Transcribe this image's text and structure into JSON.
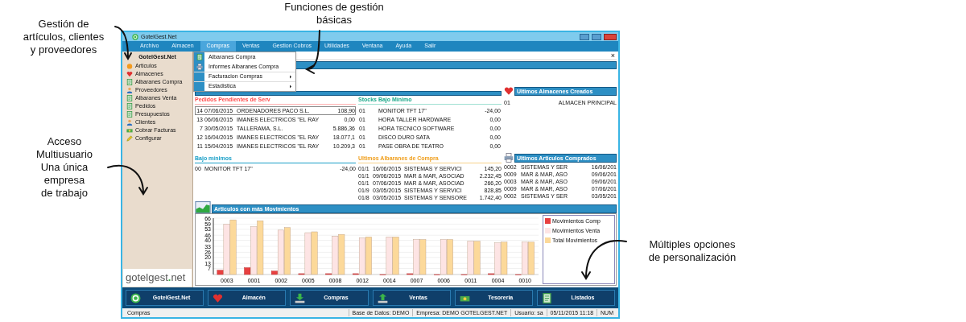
{
  "annotations": [
    {
      "kind": "top-left",
      "lines": [
        "Gestión de",
        "artículos, clientes",
        "y proveedores"
      ]
    },
    {
      "kind": "top-center",
      "lines": [
        "Funciones de gestión",
        "básicas"
      ]
    },
    {
      "kind": "mid-left",
      "lines": [
        "Acceso",
        "Multiusuario",
        "Una única",
        "empresa",
        "de trabajo"
      ]
    },
    {
      "kind": "bottom-right",
      "lines": [
        "Múltiples opciones",
        "de personalización"
      ]
    }
  ],
  "window": {
    "title": "GotelGest.Net"
  },
  "menu": [
    {
      "label": "Archivo",
      "selected": false
    },
    {
      "label": "Almacen",
      "selected": false
    },
    {
      "label": "Compras",
      "selected": true
    },
    {
      "label": "Ventas",
      "selected": false
    },
    {
      "label": "Gestion Cobros",
      "selected": false
    },
    {
      "label": "Utilidades",
      "selected": false
    },
    {
      "label": "Ventana",
      "selected": false
    },
    {
      "label": "Ayuda",
      "selected": false
    },
    {
      "label": "Salir",
      "selected": false
    }
  ],
  "dropdown": [
    {
      "label": "Albaranes Compra",
      "kind": "document"
    },
    {
      "label": "Informes Albaranes Compra",
      "kind": "printer"
    },
    {
      "label": "Facturacion Compras",
      "kind": "submenu"
    },
    {
      "label": "Estadistica",
      "kind": "submenu"
    }
  ],
  "panel": {
    "close": "×"
  },
  "sidebar": {
    "title": "GotelGest.Net",
    "items": [
      {
        "label": "Articulos",
        "kind": "ball"
      },
      {
        "label": "Almacenes",
        "kind": "heart"
      },
      {
        "label": "Albaranes Compra",
        "kind": "document"
      },
      {
        "label": "Proveedores",
        "kind": "person"
      },
      {
        "label": "Albaranes Venta",
        "kind": "document"
      },
      {
        "label": "Pedidos",
        "kind": "document"
      },
      {
        "label": "Presupuestos",
        "kind": "document"
      },
      {
        "label": "Clientes",
        "kind": "person"
      },
      {
        "label": "Cobrar Facturas",
        "kind": "money"
      },
      {
        "label": "Configurar",
        "kind": "pencil"
      }
    ],
    "logo": "gotelgest",
    "logo_dot": ".",
    "logo_end": "net"
  },
  "pedidos": {
    "title": "Pedidos Pendientes de Serv",
    "rows": [
      {
        "cells": [
          "14",
          "07/06/2015",
          "ORDENADORES PACO S.L.",
          "108,90"
        ],
        "selected": true
      },
      {
        "cells": [
          "13",
          "06/06/2015",
          "IMANES ELECTRICOS \"EL RAY",
          "0,00"
        ],
        "selected": false
      },
      {
        "cells": [
          "7",
          "30/05/2015",
          "TALLERAMA, S.L.",
          "5.886,36"
        ],
        "selected": false
      },
      {
        "cells": [
          "12",
          "16/04/2015",
          "IMANES ELECTRICOS \"EL RAY",
          "18.077,1"
        ],
        "selected": false
      },
      {
        "cells": [
          "11",
          "15/04/2015",
          "IMANES ELECTRICOS \"EL RAY",
          "10.209,3"
        ],
        "selected": false
      }
    ]
  },
  "stocks": {
    "title": "Stocks Bajo Mínimo",
    "rows": [
      [
        "01",
        "MONITOR TFT 17\"",
        "-24,00"
      ],
      [
        "01",
        "HORA TALLER HARDWARE",
        "0,00"
      ],
      [
        "01",
        "HORA TECNICO SOFTWARE",
        "0,00"
      ],
      [
        "01",
        "DISCO DURO SATA",
        "0,00"
      ],
      [
        "01",
        "PASE OBRA DE TEATRO",
        "0,00"
      ]
    ]
  },
  "almacenes": {
    "title": "Ultimos Almacenes Creados",
    "rows": [
      [
        "01",
        "ALMACEN PRINCIPAL"
      ]
    ]
  },
  "bajo_minimos": {
    "title": "Bajo mínimos",
    "rows": [
      [
        "00",
        "MONITOR TFT 17\"",
        "-24,00"
      ]
    ]
  },
  "albaranes": {
    "title": "Ultimos Albaranes de Compra",
    "rows": [
      [
        "01/1",
        "16/06/2015",
        "SISTEMAS Y SERVICI",
        "145,20"
      ],
      [
        "01/1",
        "09/06/2015",
        "MAR & MAR, ASOCIAD",
        "2.232,45"
      ],
      [
        "01/1",
        "07/06/2015",
        "MAR & MAR, ASOCIAD",
        "266,20"
      ],
      [
        "01/9",
        "03/05/2015",
        "SISTEMAS Y SERVICI",
        "828,85"
      ],
      [
        "01/8",
        "03/05/2015",
        "SISTEMAS Y SENSORE",
        "1.742,40"
      ]
    ]
  },
  "comprados": {
    "title": "Ultimos Articulos Comprados",
    "rows": [
      [
        "0002",
        "SISTEMAS Y SER",
        "16/06/201"
      ],
      [
        "0009",
        "MAR & MAR, ASO",
        "09/06/201"
      ],
      [
        "0003",
        "MAR & MAR, ASO",
        "09/06/201"
      ],
      [
        "0009",
        "MAR & MAR, ASO",
        "07/06/201"
      ],
      [
        "0002",
        "SISTEMAS Y SER",
        "03/05/201"
      ]
    ]
  },
  "movimientos": {
    "title": "Articulos con más Movimientos",
    "chart_data": {
      "type": "bar",
      "grid": true,
      "categories": [
        "0003",
        "0001",
        "0002",
        "0005",
        "0008",
        "0012",
        "0014",
        "0007",
        "0006",
        "0011",
        "0004",
        "0010"
      ],
      "ylim": [
        0,
        66
      ],
      "yticks": [
        7,
        13,
        20,
        26,
        33,
        40,
        46,
        53,
        59,
        66
      ],
      "series": [
        {
          "name": "Movimientos Comp",
          "color": "#e84040",
          "values": [
            5,
            8,
            4,
            1,
            1,
            1,
            0,
            1,
            0,
            0,
            1,
            0
          ]
        },
        {
          "name": "Movimientos Venta",
          "color": "#fde4e4",
          "values": [
            59,
            56,
            52,
            49,
            45,
            43,
            44,
            41,
            41,
            39,
            37,
            38
          ]
        },
        {
          "name": "Total Movimientos",
          "color": "#fcd99a",
          "values": [
            64,
            63,
            55,
            50,
            47,
            44,
            44,
            41,
            41,
            39,
            38,
            38
          ]
        }
      ]
    }
  },
  "toolbar": [
    {
      "label": "GotelGest.Net",
      "kind": "logo"
    },
    {
      "label": "Almacén",
      "kind": "heart"
    },
    {
      "label": "Compras",
      "kind": "download"
    },
    {
      "label": "Ventas",
      "kind": "upload"
    },
    {
      "label": "Tesoreria",
      "kind": "money"
    },
    {
      "label": "Listados",
      "kind": "document"
    }
  ],
  "status_bar": [
    "Compras",
    "Base de Datos: DEMO",
    "Empresa: DEMO GOTELGEST.NET",
    "Usuario: sa",
    "05/11/2015 11:18",
    "NUM"
  ]
}
